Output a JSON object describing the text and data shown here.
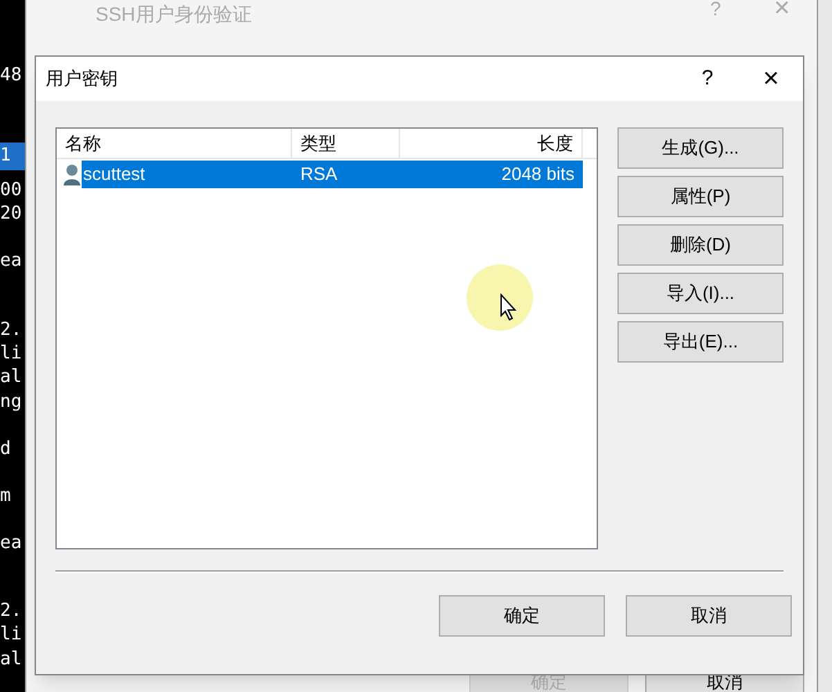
{
  "terminal": {
    "lines": [
      "48",
      "1",
      "00",
      "20",
      "ea",
      "2.",
      "li",
      "al",
      "ng",
      "d",
      "m",
      "ea",
      "2.",
      "li",
      "al"
    ]
  },
  "back_dialog": {
    "title": "SSH用户身份验证",
    "help": "?",
    "close": "×",
    "buttons": [
      {
        "label": "确定",
        "disabled": true
      },
      {
        "label": "取消",
        "disabled": false
      }
    ]
  },
  "dialog": {
    "title": "用户密钥",
    "help": "?",
    "close": "×",
    "table": {
      "columns": [
        "名称",
        "类型",
        "长度"
      ],
      "rows": [
        {
          "name": "scuttest",
          "type": "RSA",
          "length": "2048 bits",
          "selected": true
        }
      ]
    },
    "side_buttons": [
      "生成(G)...",
      "属性(P)",
      "删除(D)",
      "导入(I)...",
      "导出(E)..."
    ],
    "buttons": [
      "确定",
      "取消"
    ]
  }
}
